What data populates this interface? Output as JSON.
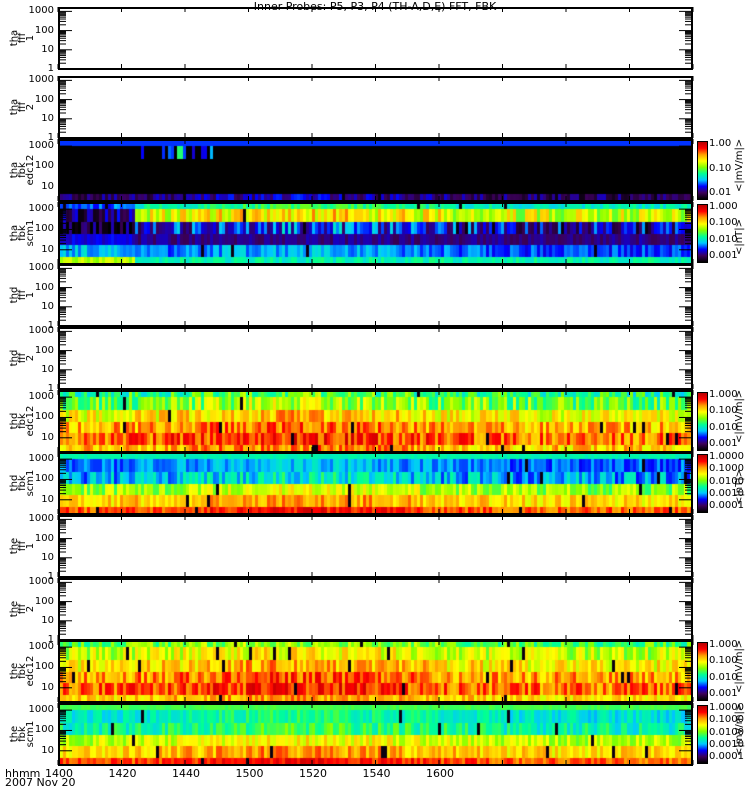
{
  "chart_data": {
    "type": "heatmap",
    "title": "Inner Probes: P5, P3, P4 (TH-A,D,E) FFT, FBK",
    "xlabel": "hhmm",
    "date_label": "2007 Nov 20",
    "x_ticks": [
      "1400",
      "1420",
      "1440",
      "1500",
      "1520",
      "1540",
      "1600"
    ],
    "x_tick_values": [
      1400,
      1420,
      1440,
      1460,
      1480,
      1500,
      1520,
      1540,
      1560,
      1580,
      1600
    ],
    "x_range": [
      "1400",
      "1600"
    ],
    "colormap": [
      "#000000",
      "#3c005a",
      "#0000ff",
      "#00c8ff",
      "#00ff96",
      "#82ff00",
      "#ffff00",
      "#ffa000",
      "#ff0000",
      "#b40000"
    ],
    "panels": [
      {
        "label": [
          "tha",
          "fff",
          "1"
        ],
        "yticks": [
          "1000",
          "100",
          "10",
          "1"
        ],
        "yrange": [
          1,
          1500
        ],
        "empty": true
      },
      {
        "label": [
          "tha",
          "fff",
          "2"
        ],
        "yticks": [
          "1000",
          "100",
          "10",
          "1"
        ],
        "yrange": [
          1,
          1500
        ],
        "empty": true
      },
      {
        "label": [
          "tha",
          "fbk",
          "edc12"
        ],
        "yticks": [
          "1000",
          "100",
          "10"
        ],
        "yrange": [
          2,
          2000
        ],
        "colorbar": {
          "ticks": [
            "1.00",
            "0.10",
            "0.01"
          ],
          "units": "<|mV/m|>"
        },
        "bands": [
          0.25,
          0.0,
          0.0,
          0.0,
          0.0,
          0.1
        ],
        "jitter": [
          0,
          0,
          0,
          0,
          0,
          0.08
        ],
        "burst": {
          "from": 1425,
          "to": 1448,
          "band": 1,
          "level": 0.18
        }
      },
      {
        "label": [
          "tha",
          "fbk",
          "scm1"
        ],
        "yticks": [
          "1000",
          "100",
          "10"
        ],
        "yrange": [
          2,
          2000
        ],
        "colorbar": {
          "ticks": [
            "1.000",
            "0.100",
            "0.010",
            "0.001"
          ],
          "units": "<|nT|>"
        },
        "bands": [
          0.26,
          0.1,
          0.03,
          0.2,
          0.33,
          0.6
        ],
        "active_from": 1423,
        "active_bands": [
          0.4,
          0.62,
          0.18,
          0.14,
          0.25,
          0.42
        ],
        "jitter": [
          0.06,
          0.12,
          0.14,
          0.04,
          0.06,
          0.05
        ]
      },
      {
        "label": [
          "thd",
          "fff",
          "1"
        ],
        "yticks": [
          "1000",
          "100",
          "10",
          "1"
        ],
        "yrange": [
          1,
          1500
        ],
        "empty": true
      },
      {
        "label": [
          "thd",
          "fff",
          "2"
        ],
        "yticks": [
          "1000",
          "100",
          "10",
          "1"
        ],
        "yrange": [
          1,
          1500
        ],
        "empty": true
      },
      {
        "label": [
          "thd",
          "fbk",
          "edc12"
        ],
        "yticks": [
          "1000",
          "100",
          "10"
        ],
        "yrange": [
          2,
          2000
        ],
        "colorbar": {
          "ticks": [
            "1.000",
            "0.100",
            "0.010",
            "0.001"
          ],
          "units": "<|mV/m|>"
        },
        "bands": [
          0.45,
          0.52,
          0.66,
          0.74,
          0.8,
          0.72
        ],
        "jitter": [
          0.12,
          0.12,
          0.1,
          0.1,
          0.1,
          0.1
        ]
      },
      {
        "label": [
          "thd",
          "fbk",
          "scm1"
        ],
        "yticks": [
          "1000",
          "100",
          "10"
        ],
        "yrange": [
          2,
          2000
        ],
        "colorbar": {
          "ticks": [
            "1.0000",
            "0.1000",
            "0.0100",
            "0.0010",
            "0.0001"
          ],
          "units": "<|nT|>"
        },
        "bands": [
          0.42,
          0.27,
          0.32,
          0.56,
          0.7,
          0.82
        ],
        "jitter": [
          0.02,
          0.06,
          0.1,
          0.1,
          0.08,
          0.07
        ]
      },
      {
        "label": [
          "the",
          "fff",
          "1"
        ],
        "yticks": [
          "1000",
          "100",
          "10",
          "1"
        ],
        "yrange": [
          1,
          1500
        ],
        "empty": true
      },
      {
        "label": [
          "the",
          "fff",
          "2"
        ],
        "yticks": [
          "1000",
          "100",
          "10",
          "1"
        ],
        "yrange": [
          1,
          1500
        ],
        "empty": true
      },
      {
        "label": [
          "the",
          "fbk",
          "edc12"
        ],
        "yticks": [
          "1000",
          "100",
          "10"
        ],
        "yrange": [
          2,
          2000
        ],
        "colorbar": {
          "ticks": [
            "1.000",
            "0.100",
            "0.010",
            "0.001"
          ],
          "units": "<|mV/m|>"
        },
        "bands": [
          0.5,
          0.6,
          0.68,
          0.76,
          0.8,
          0.7
        ],
        "jitter": [
          0.1,
          0.1,
          0.1,
          0.1,
          0.1,
          0.08
        ]
      },
      {
        "label": [
          "the",
          "fbk",
          "scm1"
        ],
        "yticks": [
          "1000",
          "100",
          "10"
        ],
        "yrange": [
          2,
          2000
        ],
        "colorbar": {
          "ticks": [
            "1.0000",
            "0.1000",
            "0.0100",
            "0.0010",
            "0.0001"
          ],
          "units": "<|mV/m|>"
        },
        "bands": [
          0.5,
          0.38,
          0.42,
          0.6,
          0.7,
          0.82
        ],
        "jitter": [
          0.02,
          0.06,
          0.08,
          0.08,
          0.08,
          0.06
        ]
      }
    ]
  }
}
